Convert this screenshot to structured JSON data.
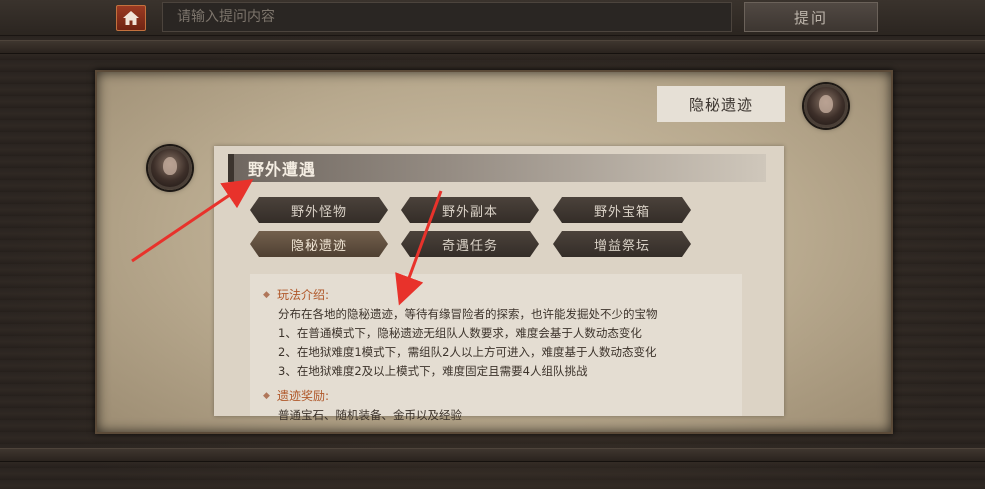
{
  "topbar": {
    "home_icon": "home-icon",
    "search_placeholder": "请输入提问内容",
    "ask_label": "提问"
  },
  "npc": {
    "label": "隐秘遗迹",
    "avatar_icon": "npc-portrait"
  },
  "guide": {
    "avatar_icon": "guide-portrait"
  },
  "section": {
    "title": "野外遭遇"
  },
  "tabs": [
    {
      "label": "野外怪物",
      "active": false
    },
    {
      "label": "野外副本",
      "active": false
    },
    {
      "label": "野外宝箱",
      "active": false
    },
    {
      "label": "隐秘遗迹",
      "active": true
    },
    {
      "label": "奇遇任务",
      "active": false
    },
    {
      "label": "增益祭坛",
      "active": false
    }
  ],
  "description": {
    "intro_title": "玩法介绍:",
    "lines": [
      "分布在各地的隐秘遗迹，等待有缘冒险者的探索，也许能发掘处不少的宝物",
      "1、在普通模式下，隐秘遗迹无组队人数要求，难度会基于人数动态变化",
      "2、在地狱难度1模式下，需组队2人以上方可进入，难度基于人数动态变化",
      "3、在地狱难度2及以上模式下，难度固定且需要4人组队挑战"
    ],
    "reward_title": "遗迹奖励:",
    "reward_text": "普通宝石、随机装备、金币以及经验"
  },
  "colors": {
    "accent": "#b0582a",
    "arrow": "#e8322b",
    "home_button": "#8a3019"
  }
}
